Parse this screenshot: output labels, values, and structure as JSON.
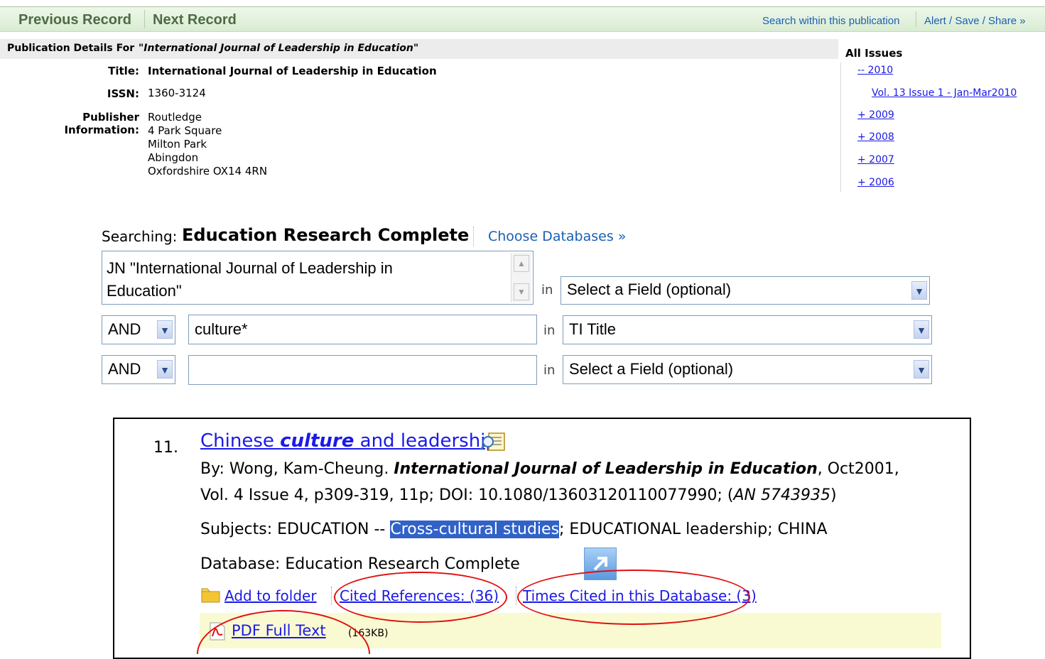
{
  "nav": {
    "previous": "Previous Record",
    "next": "Next Record",
    "search_within": "Search within this publication",
    "alert_save": "Alert / Save / Share »"
  },
  "publication": {
    "header_prefix": "Publication Details For ",
    "header_title": "\"International Journal of Leadership in Education\"",
    "title_label": "Title:",
    "title_value": "International Journal of Leadership in Education",
    "issn_label": "ISSN:",
    "issn_value": "1360-3124",
    "publisher_label_1": "Publisher",
    "publisher_label_2": "Information:",
    "publisher_lines": [
      "Routledge",
      "4 Park Square",
      "Milton Park",
      "Abingdon",
      "Oxfordshire OX14 4RN"
    ]
  },
  "issues": {
    "title": "All Issues",
    "items": [
      "-- 2010",
      "Vol. 13 Issue 1 - Jan-Mar2010",
      "+ 2009",
      "+ 2008",
      "+ 2007",
      "+ 2006"
    ]
  },
  "search": {
    "searching_label": "Searching:",
    "database": "Education Research Complete",
    "choose_db": "Choose Databases »",
    "row1_text_line1": "JN \"International Journal of Leadership in",
    "row1_text_line2": "Education\"",
    "row1_field": "Select a Field (optional)",
    "row2_bool": "AND",
    "row2_text": "culture*",
    "row2_field": "TI Title",
    "row3_bool": "AND",
    "row3_text": "",
    "row3_field": "Select a Field (optional)",
    "in_label": "in"
  },
  "result": {
    "number": "11.",
    "title_pre": "Chinese ",
    "title_em": "culture",
    "title_post": " and leadership.",
    "by_prefix": "By: Wong, Kam-Cheung. ",
    "journal": "International Journal of Leadership in Education",
    "by_suffix": ", Oct2001,",
    "line2_pre": "Vol. 4 Issue 4, p309-319, 11p; DOI: 10.1080/13603120110077990; (",
    "line2_an": "AN 5743935",
    "line2_post": ")",
    "subjects_pre": "Subjects: EDUCATION -- ",
    "subjects_hl": "Cross-cultural studies",
    "subjects_post": "; EDUCATIONAL leadership; CHINA",
    "database": "Database: Education Research Complete",
    "add_folder": "Add to folder",
    "cited_refs": "Cited References: (36)",
    "times_cited": "Times Cited in this Database: (3)",
    "pdf": "PDF Full Text",
    "pdf_size": "(163KB)"
  },
  "colors": {
    "link": "#1a1ae6",
    "annotation": "#e01010",
    "highlight": "#3162c8",
    "fulltext_bg": "#fafad2"
  }
}
